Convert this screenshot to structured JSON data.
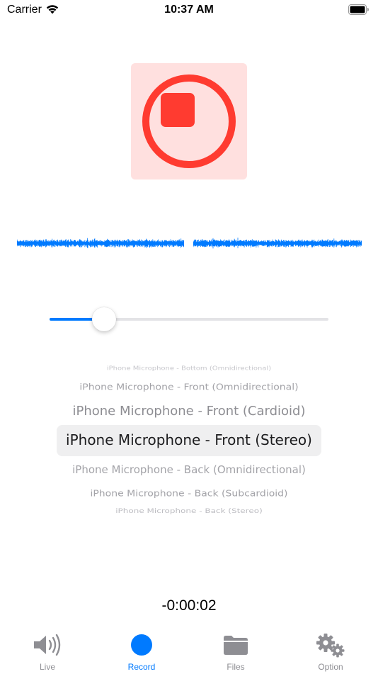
{
  "status_bar": {
    "carrier": "Carrier",
    "time": "10:37 AM",
    "wifi_icon": "wifi-icon",
    "battery_icon": "battery-icon"
  },
  "record": {
    "state": "recording",
    "icon": "stop-icon",
    "accent_color": "#ff3b30",
    "background_color": "#ffe0df"
  },
  "waveform": {
    "channels": 2,
    "color": "#007aff"
  },
  "gain_slider": {
    "value": 0.195,
    "accent_color": "#007aff"
  },
  "input_picker": {
    "options": [
      "iPhone Microphone - Bottom (Omnidirectional)",
      "iPhone Microphone - Front (Omnidirectional)",
      "iPhone Microphone - Front (Cardioid)",
      "iPhone Microphone - Front (Stereo)",
      "iPhone Microphone - Back (Omnidirectional)",
      "iPhone Microphone - Back (Subcardioid)",
      "iPhone Microphone - Back (Stereo)"
    ],
    "selected_index": 3
  },
  "timer": "-0:00:02",
  "tab_bar": {
    "tabs": [
      {
        "label": "Live",
        "icon": "speaker-icon",
        "active": false
      },
      {
        "label": "Record",
        "icon": "record-dot-icon",
        "active": true
      },
      {
        "label": "Files",
        "icon": "folder-icon",
        "active": false
      },
      {
        "label": "Option",
        "icon": "gears-icon",
        "active": false
      }
    ],
    "active_color": "#007aff",
    "inactive_color": "#8e8e93"
  }
}
